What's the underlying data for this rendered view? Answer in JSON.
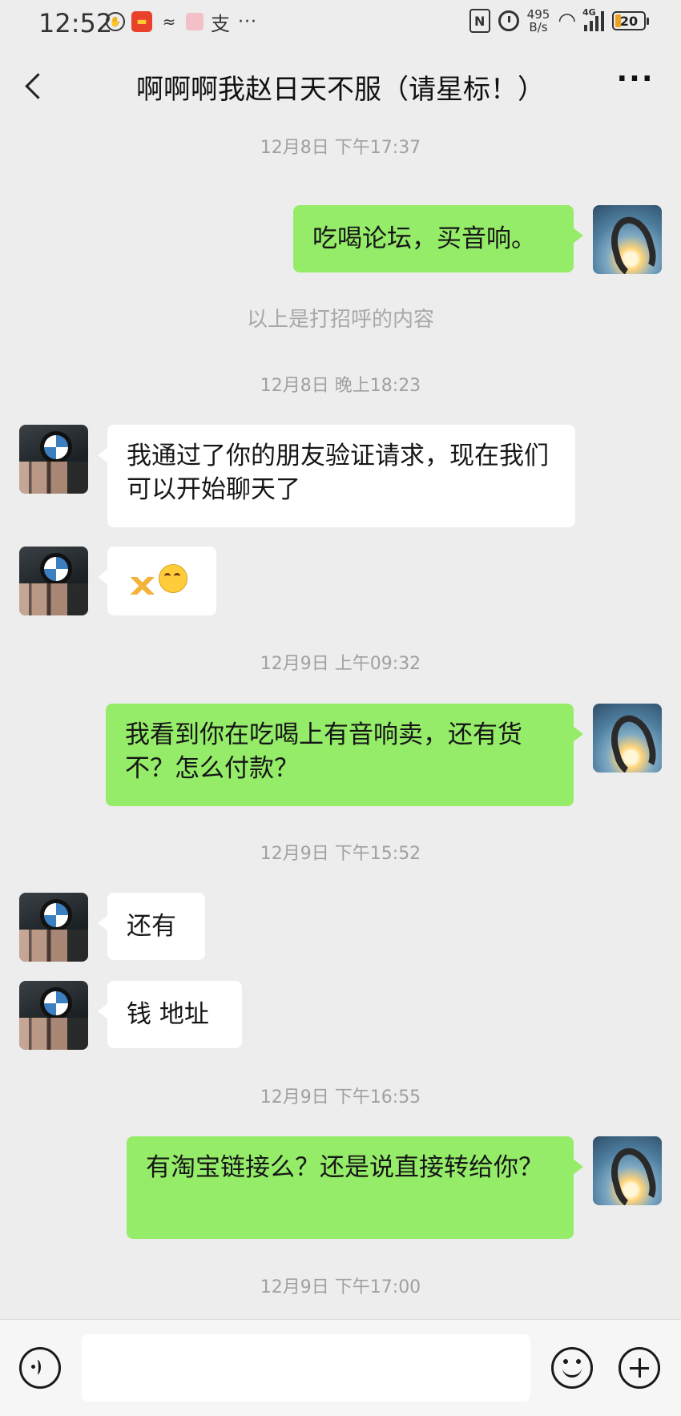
{
  "status_bar": {
    "time": "12:52",
    "left_icons": [
      "hand-shield-icon",
      "red-app-icon",
      "signal-app-icon",
      "box-app-icon",
      "alipay-icon",
      "more-dots-icon"
    ],
    "zhi_glyph": "支",
    "dots": "···",
    "nfc": "N",
    "net_speed_value": "495",
    "net_speed_unit": "B/s",
    "network_type": "4G",
    "battery_level": "20",
    "battery_fraction": 0.2,
    "battery_color": "#f0a020"
  },
  "header": {
    "title": "啊啊啊我赵日天不服（请星标！）",
    "back_icon": "chevron-left-icon",
    "more_label": "···"
  },
  "messages": {
    "t1": "12月8日 下午17:37",
    "m1": "吃喝论坛，买音响。",
    "sys1": "以上是打招呼的内容",
    "t2": "12月8日 晚上18:23",
    "m2": "我通过了你的朋友验证请求，现在我们可以开始聊天了",
    "m3_emoji": [
      "folded-hands-emoji",
      "thinking-face-emoji"
    ],
    "t3": "12月9日 上午09:32",
    "m4": "我看到你在吃喝上有音响卖，还有货不？怎么付款？",
    "t4": "12月9日 下午15:52",
    "m5": "还有",
    "m6": "钱 地址",
    "t5": "12月9日 下午16:55",
    "m7": "有淘宝链接么？还是说直接转给你？",
    "t6": "12月9日 下午17:00"
  },
  "input_bar": {
    "value": "",
    "placeholder": "",
    "voice_icon": "voice-icon",
    "emoji_icon": "emoji-icon",
    "plus_icon": "plus-icon"
  },
  "colors": {
    "background": "#ededed",
    "my_bubble": "#95ec69",
    "their_bubble": "#ffffff",
    "timestamp_text": "#a0a0a0"
  }
}
